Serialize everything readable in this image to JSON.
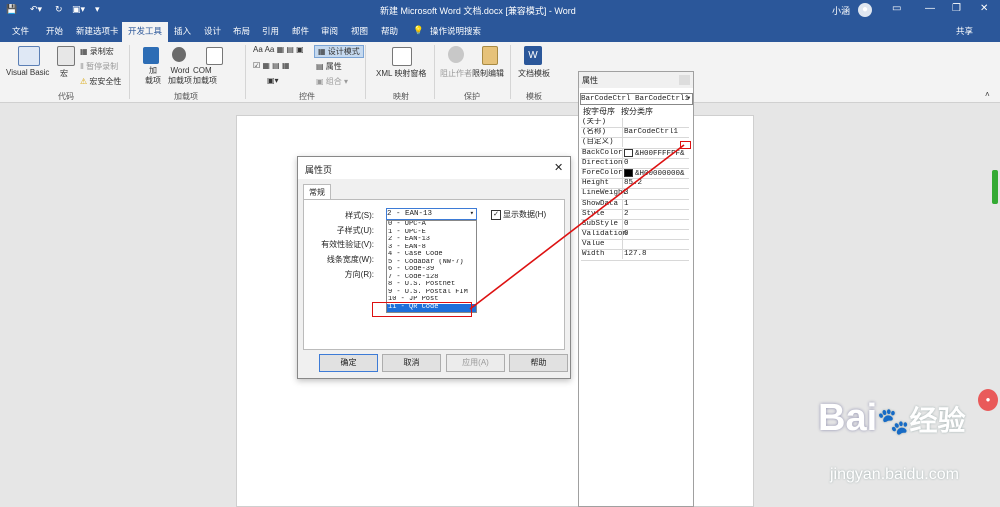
{
  "window": {
    "title": "新建 Microsoft Word 文档.docx [兼容模式] - Word",
    "user": "小涵",
    "share": "共享"
  },
  "tabs": [
    "文件",
    "开始",
    "新建选项卡",
    "开发工具",
    "插入",
    "设计",
    "布局",
    "引用",
    "邮件",
    "审阅",
    "视图",
    "帮助"
  ],
  "tell_me": "操作说明搜索",
  "ribbon": {
    "code": {
      "visual_basic": "Visual Basic",
      "macro": "宏",
      "record": "录制宏",
      "pause": "暂停录制",
      "security": "宏安全性",
      "group": "代码"
    },
    "addins": {
      "addins": "加\n载项",
      "word": "Word\n加载项",
      "com": "COM\n加载项",
      "group": "加载项"
    },
    "controls": {
      "design": "设计模式",
      "properties": "属性",
      "group_btn": "组合",
      "group": "控件"
    },
    "mapping": {
      "xml": "XML 映射窗格",
      "group": "映射"
    },
    "protect": {
      "block": "阻止作者",
      "restrict": "限制编辑",
      "group": "保护"
    },
    "templates": {
      "doc_template": "文档模板",
      "group": "模板"
    }
  },
  "props": {
    "title": "属性",
    "combo": "BarCodeCtrl BarCodeCtrl1",
    "tab_alpha": "按字母序",
    "tab_cat": "按分类序",
    "rows": [
      {
        "k": "(关于)",
        "v": ""
      },
      {
        "k": "(名称)",
        "v": "BarCodeCtrl1"
      },
      {
        "k": "(自定义)",
        "v": ""
      },
      {
        "k": "BackColor",
        "v": "&H00FFFFFF&",
        "swatch": "#ffffff"
      },
      {
        "k": "Direction",
        "v": "0"
      },
      {
        "k": "ForeColor",
        "v": "&H00000000&",
        "swatch": "#000000"
      },
      {
        "k": "Height",
        "v": "85.2"
      },
      {
        "k": "LineWeight",
        "v": "3"
      },
      {
        "k": "ShowData",
        "v": "1"
      },
      {
        "k": "Style",
        "v": "2"
      },
      {
        "k": "SubStyle",
        "v": "0"
      },
      {
        "k": "Validation",
        "v": "0"
      },
      {
        "k": "Value",
        "v": ""
      },
      {
        "k": "Width",
        "v": "127.8"
      }
    ]
  },
  "dialog": {
    "title": "属性页",
    "tab": "常规",
    "style_label": "样式(S):",
    "substyle_label": "子样式(U):",
    "validation_label": "有效性验证(V):",
    "lineweight_label": "线条宽度(W):",
    "direction_label": "方向(R):",
    "style_value": "2 - EAN-13",
    "show_data": "显示数据(H)",
    "options": [
      "0 - UPC-A",
      "1 - UPC-E",
      "2 - EAN-13",
      "3 - EAN-8",
      "4 - Case Code",
      "5 - Codabar (NW-7)",
      "6 - Code-39",
      "7 - Code-128",
      "8 - U.S. Postnet",
      "9 - U.S. Postal FIM",
      "10 - JP Post",
      "11 - QR Code"
    ],
    "selected_index": 11,
    "ok": "确定",
    "cancel": "取消",
    "apply": "应用(A)",
    "help": "帮助"
  },
  "watermark": {
    "brand": "Bai",
    "brand_cn": "经验",
    "url": "jingyan.baidu.com"
  }
}
